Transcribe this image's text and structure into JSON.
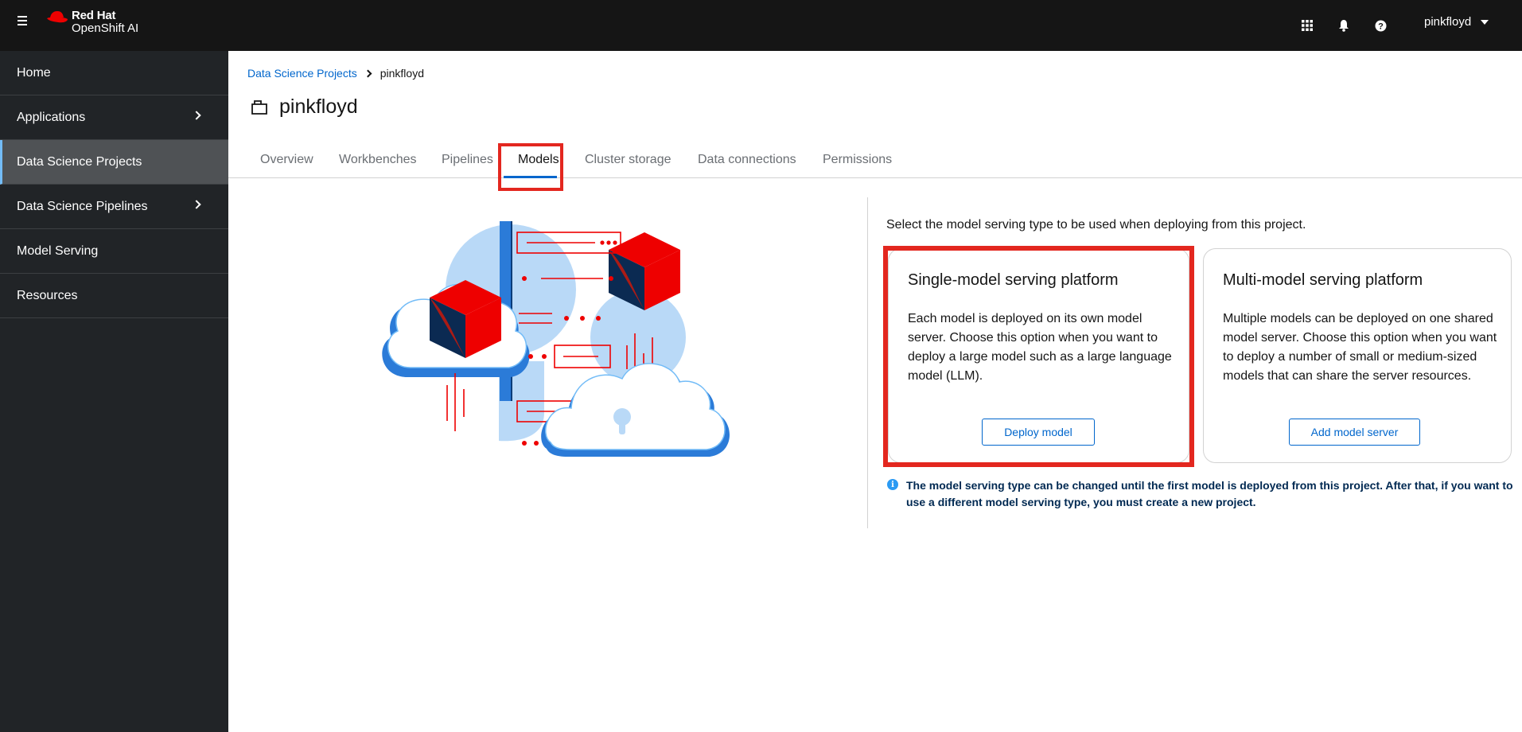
{
  "masthead": {
    "brand_line1": "Red Hat",
    "brand_line2": "OpenShift AI",
    "user": "pinkfloyd",
    "icons": [
      "menu-icon",
      "app-launcher-icon",
      "notification-bell-icon",
      "help-icon"
    ]
  },
  "sidebar": {
    "items": [
      {
        "label": "Home"
      },
      {
        "label": "Applications"
      },
      {
        "label": "Data Science Projects"
      },
      {
        "label": "Data Science Pipelines"
      },
      {
        "label": "Model Serving"
      },
      {
        "label": "Resources"
      }
    ],
    "active": "Data Science Projects"
  },
  "breadcrumb": {
    "link": "Data Science Projects",
    "current": "pinkfloyd"
  },
  "page": {
    "title": "pinkfloyd"
  },
  "tabs": [
    {
      "label": "Overview"
    },
    {
      "label": "Workbenches"
    },
    {
      "label": "Pipelines"
    },
    {
      "label": "Models"
    },
    {
      "label": "Cluster storage"
    },
    {
      "label": "Data connections"
    },
    {
      "label": "Permissions"
    }
  ],
  "active_tab": "Models",
  "serving": {
    "intro": "Select the model serving type to be used when deploying from this project.",
    "single": {
      "title": "Single-model serving platform",
      "body": "Each model is deployed on its own model server. Choose this option when you want to deploy a large model such as a large language model (LLM).",
      "button": "Deploy model"
    },
    "multi": {
      "title": "Multi-model serving platform",
      "body": "Multiple models can be deployed on one shared model server. Choose this option when you want to deploy a number of small or medium-sized models that can share the server resources.",
      "button": "Add model server"
    },
    "info": "The model serving type can be changed until the first model is deployed from this project. After that, if you want to use a different model serving type, you must create a new project."
  },
  "colors": {
    "masthead": "#151515",
    "sidebar": "#212427",
    "link": "#0066cc",
    "highlight": "#e3271f",
    "info_text": "#002952"
  }
}
